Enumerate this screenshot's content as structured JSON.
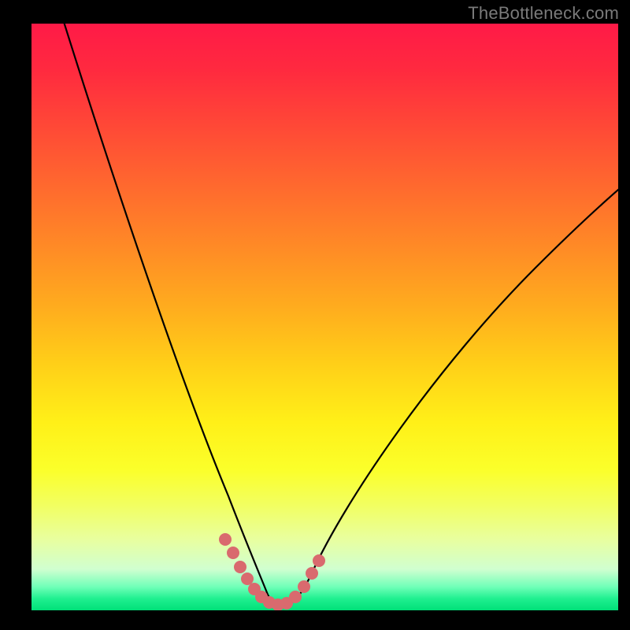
{
  "watermark": "TheBottleneck.com",
  "chart_data": {
    "type": "line",
    "title": "",
    "xlabel": "",
    "ylabel": "",
    "xlim": [
      0,
      100
    ],
    "ylim": [
      0,
      100
    ],
    "series": [
      {
        "name": "curve-left",
        "x": [
          5,
          10,
          15,
          20,
          25,
          28,
          30,
          33,
          35,
          36,
          37,
          38,
          39,
          40
        ],
        "values": [
          102,
          80,
          62,
          46,
          30,
          20,
          15,
          10,
          6,
          4,
          3,
          2.2,
          1.7,
          1.3
        ]
      },
      {
        "name": "curve-right",
        "x": [
          40,
          42,
          45,
          48,
          52,
          58,
          65,
          73,
          82,
          92,
          100
        ],
        "values": [
          1.3,
          1.8,
          4,
          7,
          12,
          20,
          30,
          41,
          53,
          65,
          74
        ]
      },
      {
        "name": "highlight-points",
        "x": [
          33,
          34,
          35.5,
          36.5,
          38,
          39.5,
          41,
          42.5,
          44,
          45.5,
          47,
          48.5
        ],
        "values": [
          10,
          8,
          5,
          3.5,
          2.3,
          1.8,
          1.7,
          2.1,
          3.2,
          4.5,
          6,
          7.5
        ]
      }
    ],
    "gradient_stops": [
      {
        "pct": 0,
        "color": "#ff1a47"
      },
      {
        "pct": 50,
        "color": "#ffcf18"
      },
      {
        "pct": 80,
        "color": "#f2ff60"
      },
      {
        "pct": 100,
        "color": "#00e078"
      }
    ]
  }
}
